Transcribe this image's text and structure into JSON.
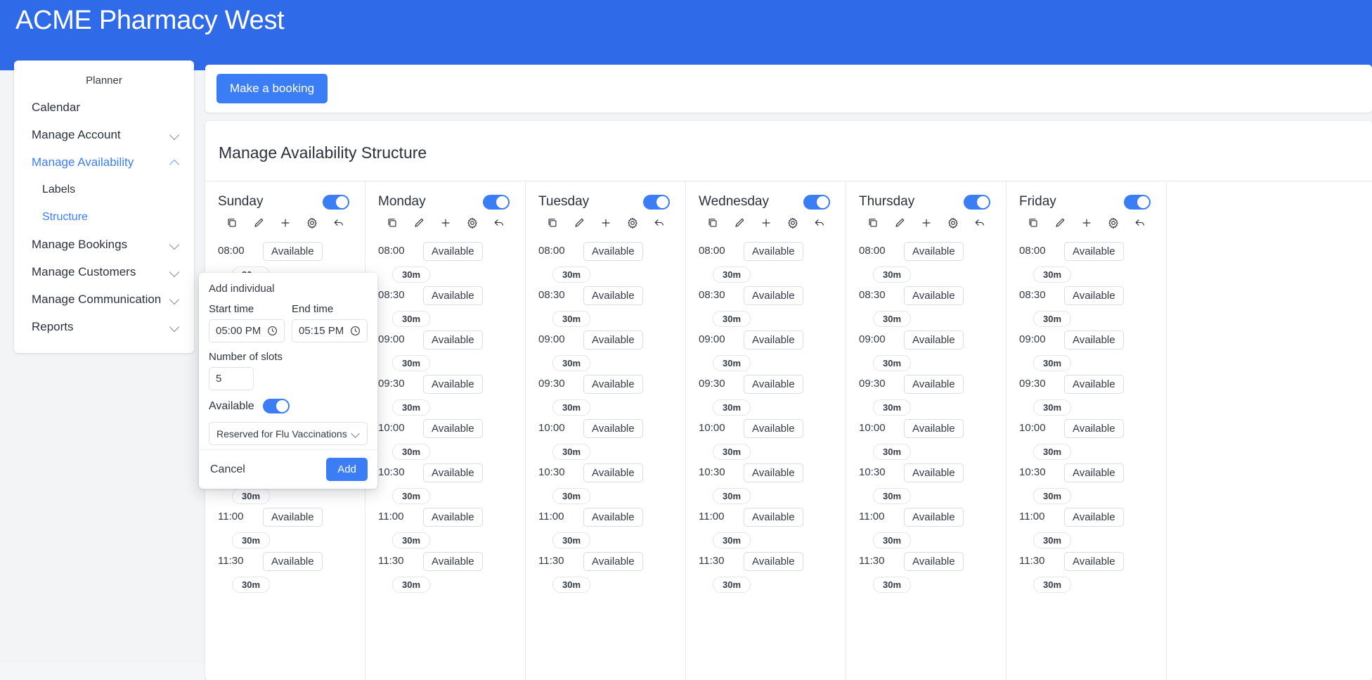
{
  "app": {
    "title": "ACME Pharmacy West",
    "brand_color": "#2f6ae8",
    "accent_color": "#3b7df5"
  },
  "sidebar": {
    "heading": "Planner",
    "items": [
      {
        "label": "Calendar",
        "chevron": "",
        "state": "normal",
        "level": 0
      },
      {
        "label": "Manage Account",
        "chevron": "chevron-down-icon",
        "state": "normal",
        "level": 0
      },
      {
        "label": "Manage Availability",
        "chevron": "chevron-up-icon",
        "state": "active",
        "level": 0
      },
      {
        "label": "Labels",
        "chevron": "",
        "state": "normal",
        "level": 1
      },
      {
        "label": "Structure",
        "chevron": "",
        "state": "active",
        "level": 1
      },
      {
        "label": "Manage Bookings",
        "chevron": "chevron-down-icon",
        "state": "normal",
        "level": 0
      },
      {
        "label": "Manage Customers",
        "chevron": "chevron-down-icon",
        "state": "normal",
        "level": 0
      },
      {
        "label": "Manage Communication",
        "chevron": "chevron-down-icon",
        "state": "normal",
        "level": 0
      },
      {
        "label": "Reports",
        "chevron": "chevron-down-icon",
        "state": "normal",
        "level": 0
      }
    ]
  },
  "toolbar": {
    "make_booking_label": "Make a booking"
  },
  "main": {
    "panel_title": "Manage Availability Structure"
  },
  "day_icons": [
    "copy-icon",
    "edit-pencil-icon",
    "plus-icon",
    "gear-icon",
    "undo-arrow-icon"
  ],
  "slot_chip_label": "Available",
  "slot_duration_label": "30m",
  "slot_times": [
    "08:00",
    "08:30",
    "09:00",
    "09:30",
    "10:00",
    "10:30",
    "11:00",
    "11:30"
  ],
  "days": [
    {
      "name": "Sunday",
      "enabled": true
    },
    {
      "name": "Monday",
      "enabled": true
    },
    {
      "name": "Tuesday",
      "enabled": true
    },
    {
      "name": "Wednesday",
      "enabled": true
    },
    {
      "name": "Thursday",
      "enabled": true
    },
    {
      "name": "Friday",
      "enabled": true
    }
  ],
  "popover": {
    "title": "Add individual",
    "start_label": "Start time",
    "start_value": "05:00 PM",
    "end_label": "End time",
    "end_value": "05:15 PM",
    "slots_label": "Number of slots",
    "slots_value": "5",
    "available_label": "Available",
    "available_on": true,
    "label_select_value": "Reserved for Flu Vaccinations",
    "cancel_label": "Cancel",
    "add_label": "Add"
  }
}
